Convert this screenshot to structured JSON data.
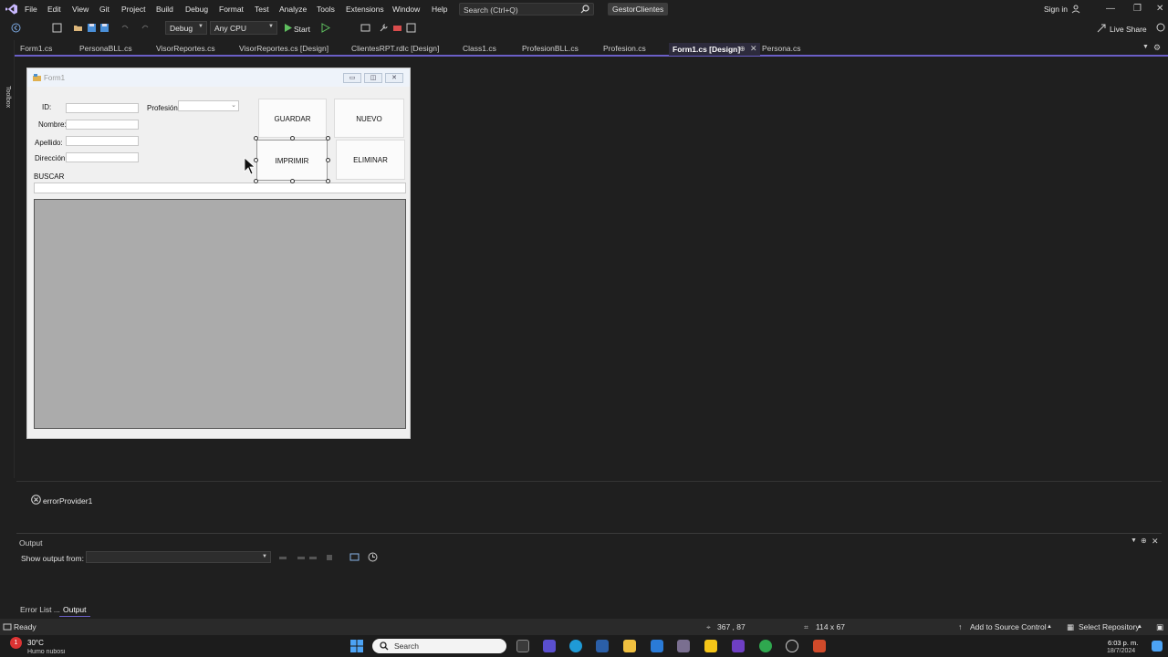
{
  "menu": {
    "items": [
      "File",
      "Edit",
      "View",
      "Git",
      "Project",
      "Build",
      "Debug",
      "Format",
      "Test",
      "Analyze",
      "Tools",
      "Extensions",
      "Window",
      "Help"
    ],
    "search_placeholder": "Search (Ctrl+Q)",
    "solution_name": "GestorClientes",
    "sign_in": "Sign in"
  },
  "toolbar": {
    "config": "Debug",
    "platform": "Any CPU",
    "start_label": "Start",
    "live_share": "Live Share"
  },
  "side": {
    "toolbox": "Toolbox"
  },
  "tabs": [
    {
      "label": "Form1.cs"
    },
    {
      "label": "PersonaBLL.cs"
    },
    {
      "label": "VisorReportes.cs"
    },
    {
      "label": "VisorReportes.cs [Design]"
    },
    {
      "label": "ClientesRPT.rdlc [Design]"
    },
    {
      "label": "Class1.cs"
    },
    {
      "label": "ProfesionBLL.cs"
    },
    {
      "label": "Profesion.cs"
    },
    {
      "label": "Form1.cs [Design]",
      "active": true
    },
    {
      "label": "Persona.cs"
    }
  ],
  "form": {
    "title": "Form1",
    "labels": {
      "id": "ID:",
      "nombre": "Nombre:",
      "apellido": "Apellido:",
      "direccion": "Dirección:",
      "buscar": "BUSCAR",
      "profesion": "Profesión:"
    },
    "buttons": {
      "guardar": "GUARDAR",
      "nuevo": "NUEVO",
      "imprimir": "IMPRIMIR",
      "eliminar": "ELIMINAR"
    }
  },
  "tray": {
    "component": "errorProvider1"
  },
  "output": {
    "title": "Output",
    "show_from_label": "Show output from:"
  },
  "bottom_tabs": [
    "Error List ...",
    "Output"
  ],
  "status": {
    "ready": "Ready",
    "position": "367 , 87",
    "size": "114 x 67",
    "source_control": "Add to Source Control",
    "repository": "Select Repository"
  },
  "taskbar": {
    "weather_temp": "30°C",
    "weather_desc": "Humo nubosi",
    "search": "Search",
    "time": "6:03 p. m.",
    "date": "18/7/2024",
    "notification_count": "1"
  },
  "colors": {
    "accent": "#6b5fc7",
    "background": "#1f1f1f",
    "form_bg": "#f0f0f0",
    "grid_bg": "#ababab"
  }
}
